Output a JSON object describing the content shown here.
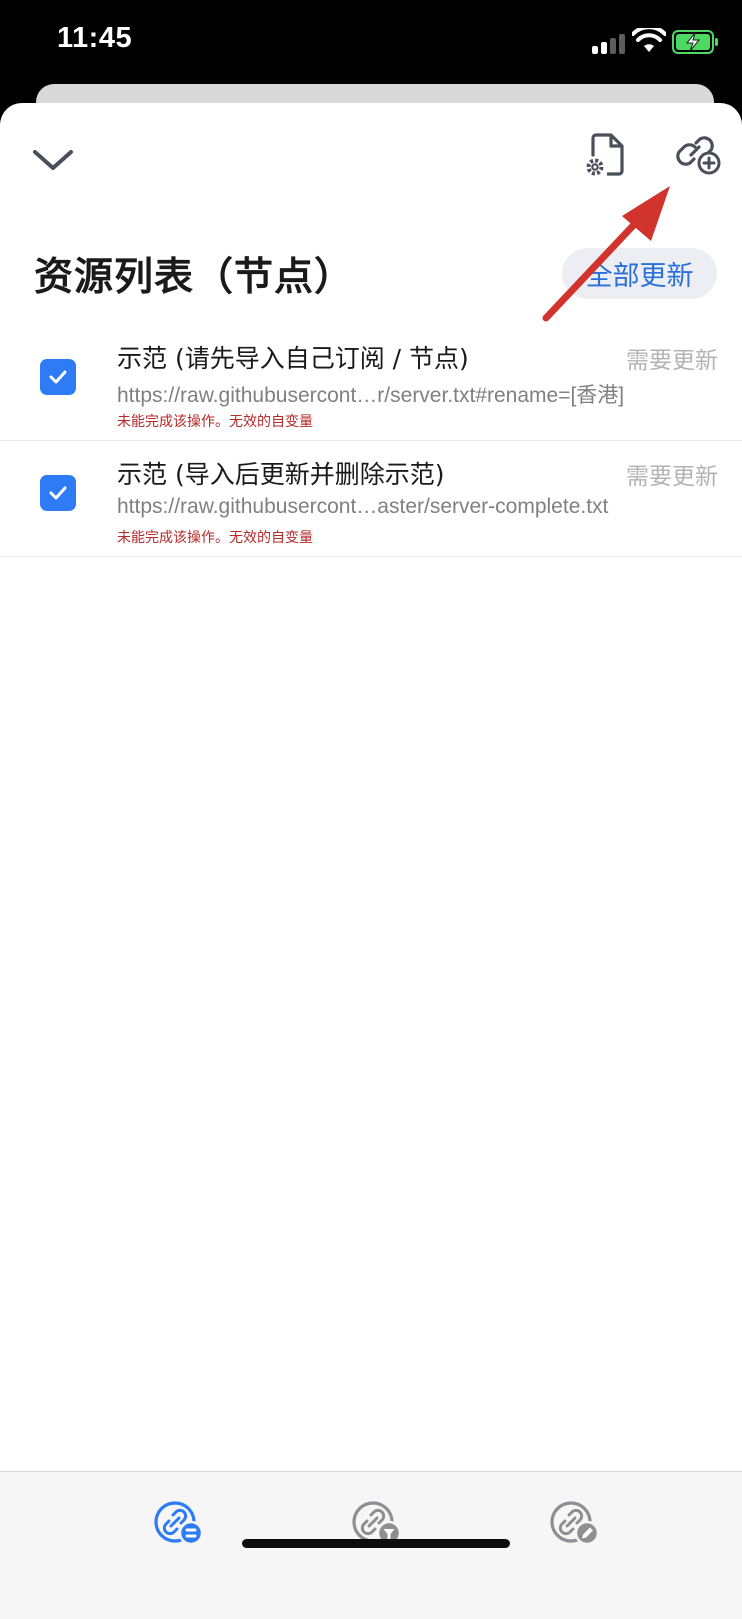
{
  "status_bar": {
    "time": "11:45"
  },
  "header": {
    "title": "资源列表（节点）",
    "update_all_label": "全部更新"
  },
  "items": [
    {
      "name": "示范 (请先导入自己订阅 / 节点)",
      "status": "需要更新",
      "url": "https://raw.githubusercont…r/server.txt#rename=[香港]",
      "error": "未能完成该操作。无效的自变量",
      "checked": true
    },
    {
      "name": "示范 (导入后更新并删除示范)",
      "status": "需要更新",
      "url": "https://raw.githubusercont…aster/server-complete.txt",
      "error": "未能完成该操作。无效的自变量",
      "checked": true
    }
  ],
  "colors": {
    "accent": "#2d7cf6",
    "error": "#b52a2a",
    "annotation_arrow": "#d0342c"
  },
  "icons": {
    "collapse": "chevron-down-icon",
    "file_settings": "file-settings-icon",
    "add_link": "link-add-icon",
    "tab_subscriptions": "link-list-icon",
    "tab_filters": "link-filter-icon",
    "tab_editor": "link-edit-icon"
  }
}
